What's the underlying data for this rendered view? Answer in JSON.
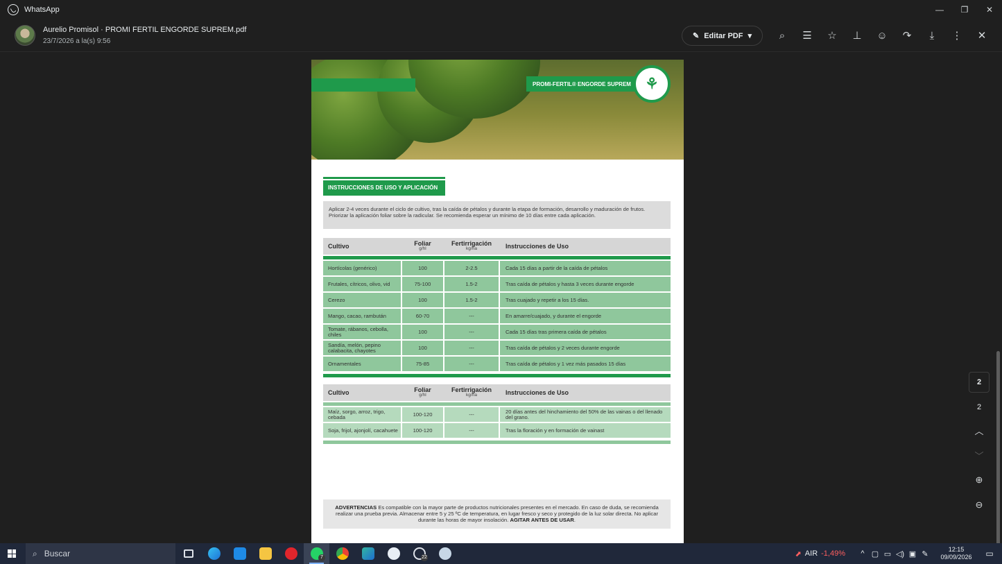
{
  "window": {
    "app_name": "WhatsApp",
    "controls": {
      "minimize": "—",
      "restore": "❐",
      "close": "✕"
    }
  },
  "header": {
    "doc_title": "Aurelio Promisol · PROMI FERTIL ENGORDE SUPREM.pdf",
    "doc_date": "23/7/2026 a la(s) 9:56",
    "edit_pdf_label": "Editar PDF",
    "tools": [
      "search-icon",
      "annotation-icon",
      "star-icon",
      "pin-icon",
      "emoji-icon",
      "forward-icon",
      "download-icon",
      "more-icon",
      "close-icon"
    ]
  },
  "document": {
    "brand_label": "PROMI-FERTIL® ENGORDE SUPREM",
    "section_title": "INSTRUCCIONES DE USO Y APLICACIÓN",
    "intro": "Aplicar 2-4 veces durante el ciclo de cultivo, tras la caída de pétalos y durante la etapa de formación, desarrollo y maduración de frutos. Priorizar la aplicación foliar sobre la radicular. Se recomienda esperar un mínimo de 10 días entre cada aplicación.",
    "table_headers": {
      "crop": "Cultivo",
      "foliar": "Foliar",
      "foliar_unit": "g/hl",
      "fert": "Fertirrigación",
      "fert_unit": "kg/ha",
      "instructions": "Instrucciones de Uso"
    },
    "table1": [
      {
        "crop": "Hortícolas (genérico)",
        "foliar": "100",
        "fert": "2-2.5",
        "instr": "Cada 15 días a partir de la caída de pétalos"
      },
      {
        "crop": "Frutales, cítricos, olivo, vid",
        "foliar": "75-100",
        "fert": "1.5-2",
        "instr": "Tras caída de pétalos y hasta 3 veces durante engorde"
      },
      {
        "crop": "Cerezo",
        "foliar": "100",
        "fert": "1.5-2",
        "instr": "Tras cuajado y repetir a los 15 días."
      },
      {
        "crop": "Mango, cacao, rambután",
        "foliar": "60-70",
        "fert": "---",
        "instr": "En amarre/cuajado, y durante el engorde"
      },
      {
        "crop": "Tomate, rábanos, cebolla, chiles",
        "foliar": "100",
        "fert": "---",
        "instr": "Cada 15 días tras primera caída de pétalos"
      },
      {
        "crop": "Sandía, melón, pepino calabacita, chayotes",
        "foliar": "100",
        "fert": "---",
        "instr": "Tras caída de pétalos y 2 veces durante engorde"
      },
      {
        "crop": "Ornamentales",
        "foliar": "75-85",
        "fert": "---",
        "instr": "Tras caída de pétalos y 1 vez más pasados 15 días"
      }
    ],
    "table2": [
      {
        "crop": "Maíz, sorgo, arroz, trigo, cebada",
        "foliar": "100-120",
        "fert": "---",
        "instr": "20 días antes del hinchamiento del 50% de las vainas o del llenado del grano."
      },
      {
        "crop": "Soja, frijol, ajonjolí, cacahuete",
        "foliar": "100-120",
        "fert": "---",
        "instr": "Tras la floración y en formación de vainast"
      }
    ],
    "warning_label": "ADVERTENCIAS",
    "warning_text": " Es compatible con la mayor parte de productos nutricionales presentes en el mercado. En caso de duda, se recomienda realizar una prueba previa. Almacenar entre 5 y 25 ºC de temperatura, en lugar fresco y seco y protegido de la luz solar directa.  No aplicar durante las horas de mayor insolación. ",
    "warning_tail": "AGITAR ANTES DE USAR",
    "warning_end": "."
  },
  "page_nav": {
    "current_page": "2",
    "total_pages": "2"
  },
  "taskbar": {
    "search_placeholder": "Buscar",
    "whatsapp_badge": "7",
    "outlook_badge": "22",
    "stock_ticker": "AIR",
    "stock_change": "-1,49%",
    "time": "12:15",
    "date": "09/09/2026"
  }
}
